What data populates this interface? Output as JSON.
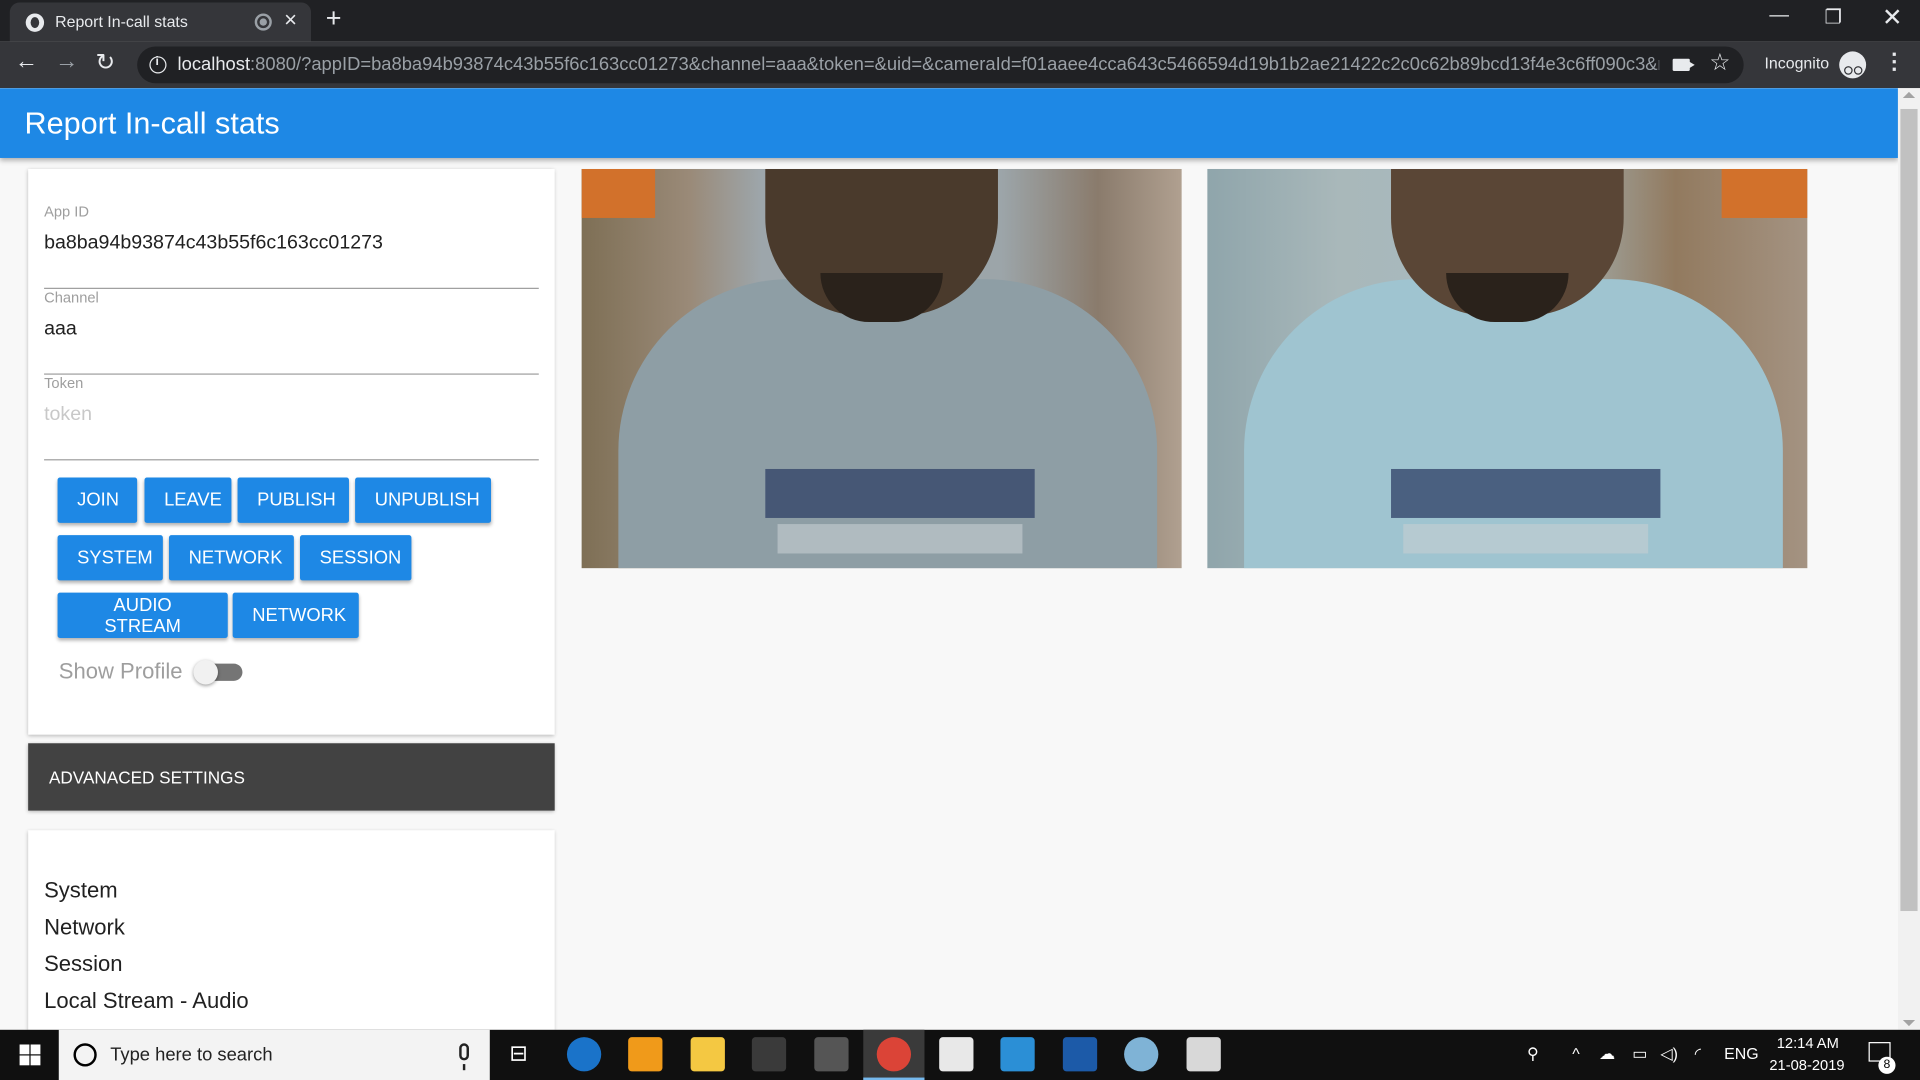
{
  "browser": {
    "tab_title": "Report In-call stats",
    "url_host": "localhost",
    "url_rest": ":8080/?appID=ba8ba94b93874c43b55f6c163cc01273&channel=aaa&token=&uid=&cameraId=f01aaee4cca643c5466594d19b1b2ae21422c2c0c62b89bcd13f4e3c6ff090c3&microp...",
    "incognito_label": "Incognito"
  },
  "header": {
    "title": "Report In-call stats"
  },
  "form": {
    "app_id": {
      "label": "App ID",
      "value": "ba8ba94b93874c43b55f6c163cc01273"
    },
    "channel": {
      "label": "Channel",
      "value": "aaa"
    },
    "token": {
      "label": "Token",
      "value": "",
      "placeholder": "token"
    }
  },
  "buttons": {
    "join": "JOIN",
    "leave": "LEAVE",
    "publish": "PUBLISH",
    "unpublish": "UNPUBLISH",
    "system": "SYSTEM",
    "network": "NETWORK",
    "session": "SESSION",
    "audio_stream": "AUDIO STREAM",
    "network_2": "NETWORK"
  },
  "show_profile": {
    "label": "Show Profile",
    "on": false
  },
  "advanced": {
    "label": "ADVANACED SETTINGS"
  },
  "stats_list": [
    "System",
    "Network",
    "Session",
    "Local Stream - Audio"
  ],
  "taskbar": {
    "search_placeholder": "Type here to search",
    "language": "ENG",
    "time": "12:14 AM",
    "date": "21-08-2019",
    "notification_count": "8"
  },
  "colors": {
    "primary": "#1e88e5",
    "advanced_bg": "#424242",
    "browser_dark": "#202124"
  }
}
